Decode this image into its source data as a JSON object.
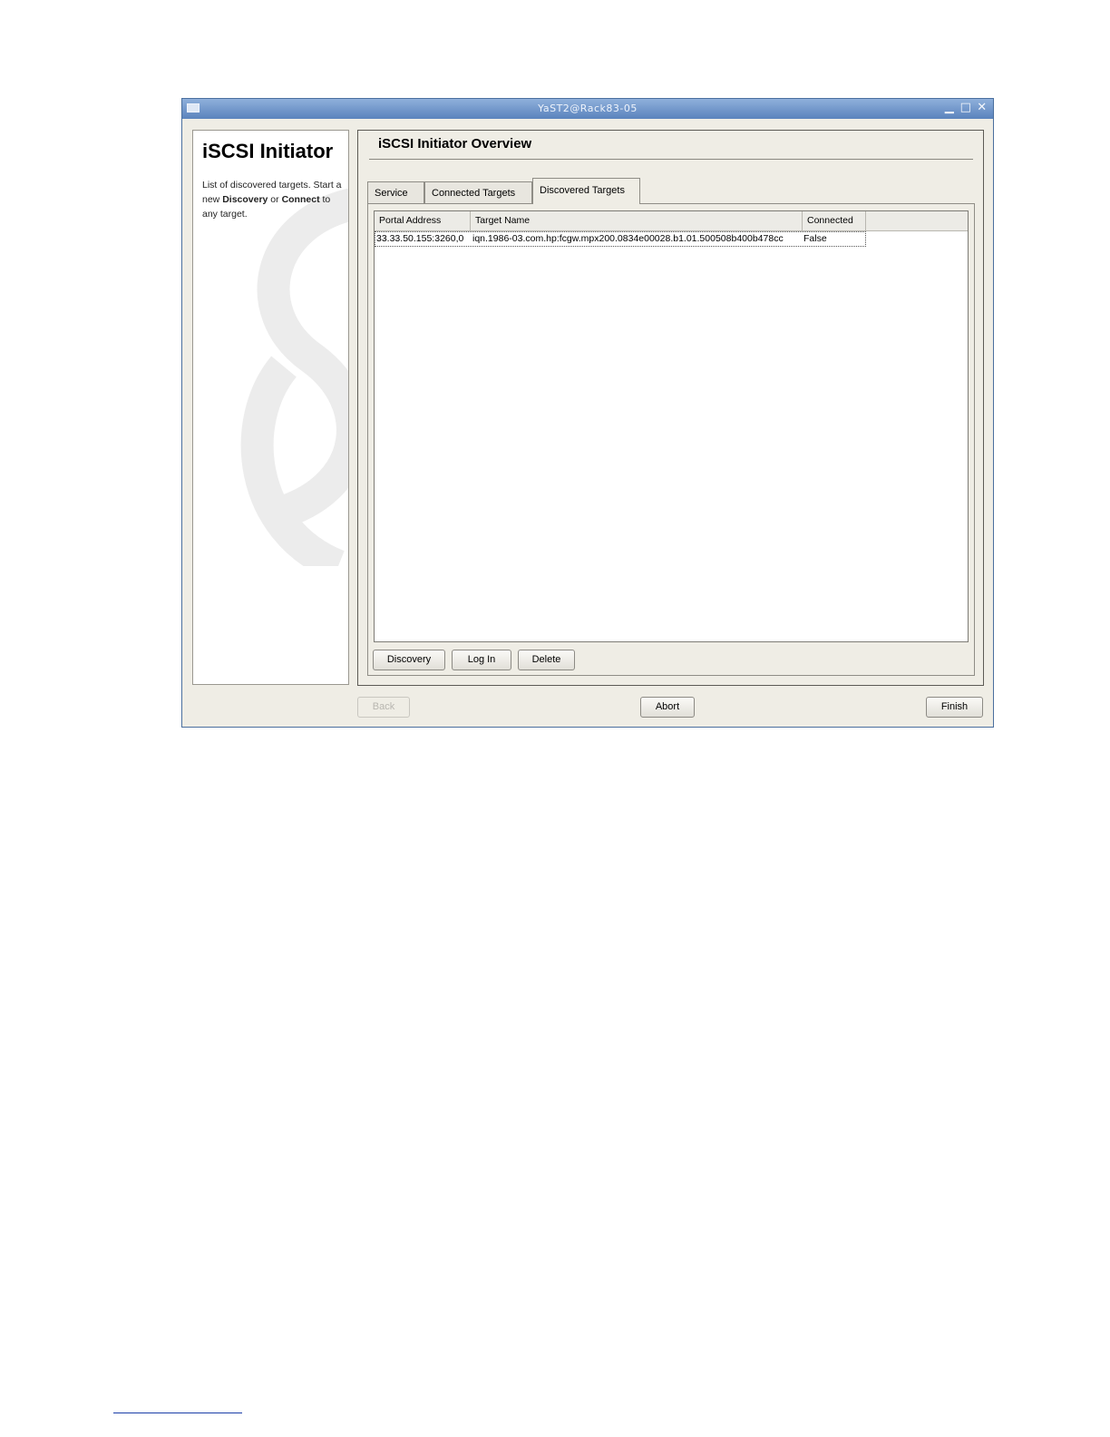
{
  "window": {
    "title": "YaST2@Rack83-05"
  },
  "help": {
    "title": "iSCSI Initiator",
    "text_part1": "List of discovered targets. Start a new ",
    "text_bold1": "Discovery",
    "text_part2": " or ",
    "text_bold2": "Connect",
    "text_part3": " to any target."
  },
  "main": {
    "heading": "iSCSI Initiator Overview",
    "tabs": [
      {
        "label": "Service"
      },
      {
        "label": "Connected Targets"
      },
      {
        "label": "Discovered Targets"
      }
    ],
    "active_tab": "Discovered Targets",
    "table": {
      "columns": [
        "Portal Address",
        "Target Name",
        "Connected",
        ""
      ],
      "rows": [
        [
          "33.33.50.155:3260,0",
          "iqn.1986-03.com.hp:fcgw.mpx200.0834e00028.b1.01.500508b400b478cc",
          "False"
        ]
      ]
    },
    "buttons": {
      "discovery": "Discovery",
      "login": "Log In",
      "delete": "Delete"
    }
  },
  "nav": {
    "back": "Back",
    "abort": "Abort",
    "finish": "Finish"
  },
  "colors": {
    "titlebar": "#5a83bd",
    "window_bg": "#efede5"
  },
  "icons": [
    "window-menu-icon",
    "minimize-icon",
    "maximize-icon",
    "close-icon"
  ]
}
